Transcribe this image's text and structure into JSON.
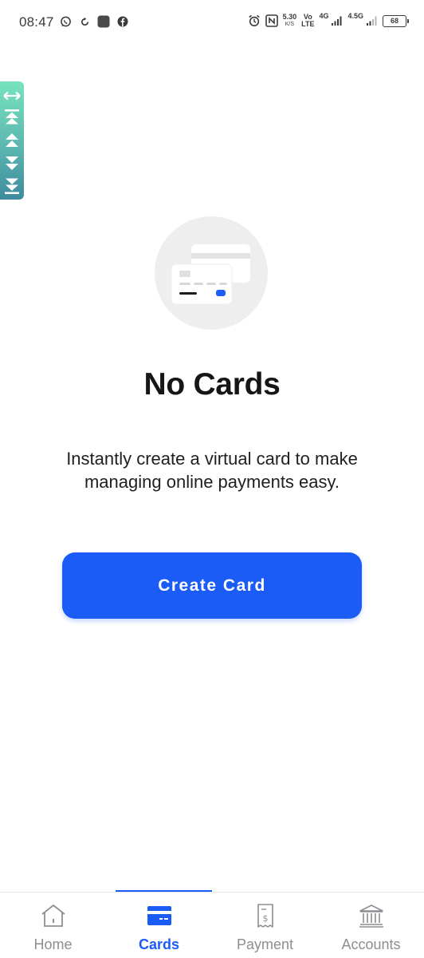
{
  "status_bar": {
    "time": "08:47",
    "left_icons": [
      "whatsapp-icon",
      "sync-icon",
      "app-icon",
      "facebook-icon"
    ],
    "net_speed_value": "5.30",
    "net_speed_unit": "K/S",
    "volte_top": "Vo",
    "volte_bottom": "LTE",
    "signal1_label": "4G",
    "signal2_label": "4.5G",
    "battery": "68"
  },
  "scroll_helper": {
    "buttons": [
      "expand-horizontal-icon",
      "scroll-to-top-icon",
      "page-up-icon",
      "page-down-icon",
      "scroll-to-bottom-icon"
    ]
  },
  "empty_state": {
    "title": "No Cards",
    "description": "Instantly create a virtual card to make managing online payments easy.",
    "button_label": "Create Card"
  },
  "bottom_nav": {
    "items": [
      {
        "label": "Home",
        "icon": "home-icon",
        "active": false
      },
      {
        "label": "Cards",
        "icon": "card-icon",
        "active": true
      },
      {
        "label": "Payment",
        "icon": "receipt-icon",
        "active": false
      },
      {
        "label": "Accounts",
        "icon": "bank-icon",
        "active": false
      }
    ]
  },
  "colors": {
    "accent": "#1a5cf5",
    "inactive": "#8e8e93",
    "illustration_bg": "#eeeeef"
  }
}
